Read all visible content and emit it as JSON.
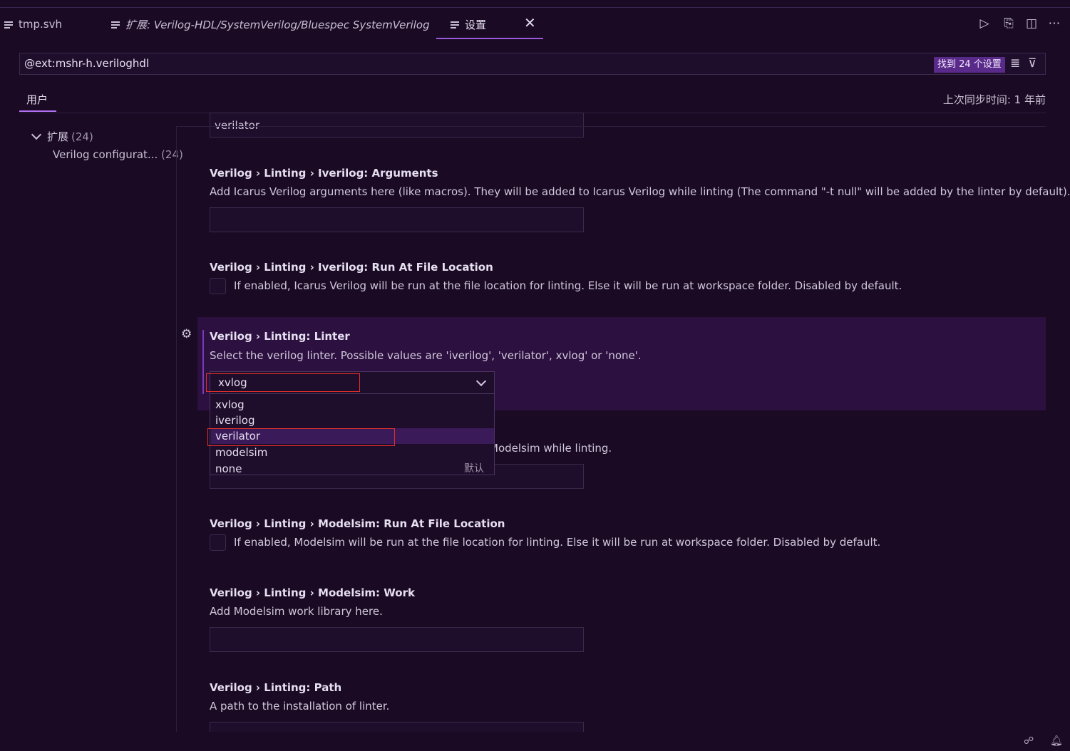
{
  "tabs": [
    {
      "label": "tmp.svh"
    },
    {
      "label": "扩展: Verilog-HDL/SystemVerilog/Bluespec SystemVerilog"
    },
    {
      "label": "设置"
    }
  ],
  "search": {
    "value": "@ext:mshr-h.veriloghdl",
    "found": "找到 24 个设置"
  },
  "scope": {
    "user_tab": "用户",
    "sync_status": "上次同步时间: 1 年前"
  },
  "toc": {
    "ext_label": "扩展",
    "ext_count": "(24)",
    "verilog_label": "Verilog configurat...",
    "verilog_count": "(24)"
  },
  "settings": {
    "cut_value": "verilator",
    "iverilog_args": {
      "prefix": "Verilog › Linting › ",
      "name": "Iverilog: Arguments",
      "desc": "Add Icarus Verilog arguments here (like macros). They will be added to Icarus Verilog while linting (The command \"-t null\" will be added by the linter by default)."
    },
    "iverilog_run": {
      "prefix": "Verilog › Linting › ",
      "name": "Iverilog: Run At File Location",
      "desc": "If enabled, Icarus Verilog will be run at the file location for linting. Else it will be run at workspace folder. Disabled by default."
    },
    "linter": {
      "prefix": "Verilog › Linting: ",
      "name": "Linter",
      "desc": "Select the verilog linter. Possible values are 'iverilog', 'verilator', xvlog' or 'none'.",
      "value": "xvlog",
      "options": [
        "xvlog",
        "iverilog",
        "verilator",
        "modelsim",
        "none"
      ],
      "default_hint": "默认"
    },
    "modelsim_args_partial": "Modelsim while linting.",
    "modelsim_run": {
      "prefix": "Verilog › Linting › ",
      "name": "Modelsim: Run At File Location",
      "desc": "If enabled, Modelsim will be run at the file location for linting. Else it will be run at workspace folder. Disabled by default."
    },
    "modelsim_work": {
      "prefix": "Verilog › Linting › ",
      "name": "Modelsim: Work",
      "desc": "Add Modelsim work library here."
    },
    "path": {
      "prefix": "Verilog › Linting: ",
      "name": "Path",
      "desc": "A path to the installation of linter."
    }
  },
  "colors": {
    "background": "#1a0a24",
    "accent": "#9a5ad8",
    "highlight_border": "#e0302a",
    "focus_row": "#2c1040"
  }
}
